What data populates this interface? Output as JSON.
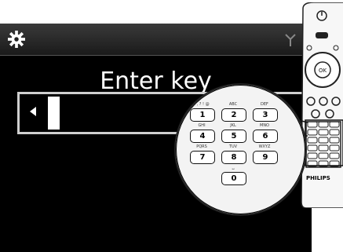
{
  "screen": {
    "title": "Enter key",
    "icons": {
      "settings": "gear-icon",
      "signal": "antenna-icon"
    }
  },
  "keypad": {
    "keys": [
      {
        "digit": "1",
        "letters": ". , ? ! @"
      },
      {
        "digit": "2",
        "letters": "ABC"
      },
      {
        "digit": "3",
        "letters": "DEF"
      },
      {
        "digit": "4",
        "letters": "GHI"
      },
      {
        "digit": "5",
        "letters": "JKL"
      },
      {
        "digit": "6",
        "letters": "MNO"
      },
      {
        "digit": "7",
        "letters": "PQRS"
      },
      {
        "digit": "8",
        "letters": "TUV"
      },
      {
        "digit": "9",
        "letters": "WXYZ"
      },
      {
        "digit": "0",
        "letters": "␣"
      }
    ]
  },
  "remote": {
    "brand": "PHILIPS",
    "ok_label": "OK"
  }
}
